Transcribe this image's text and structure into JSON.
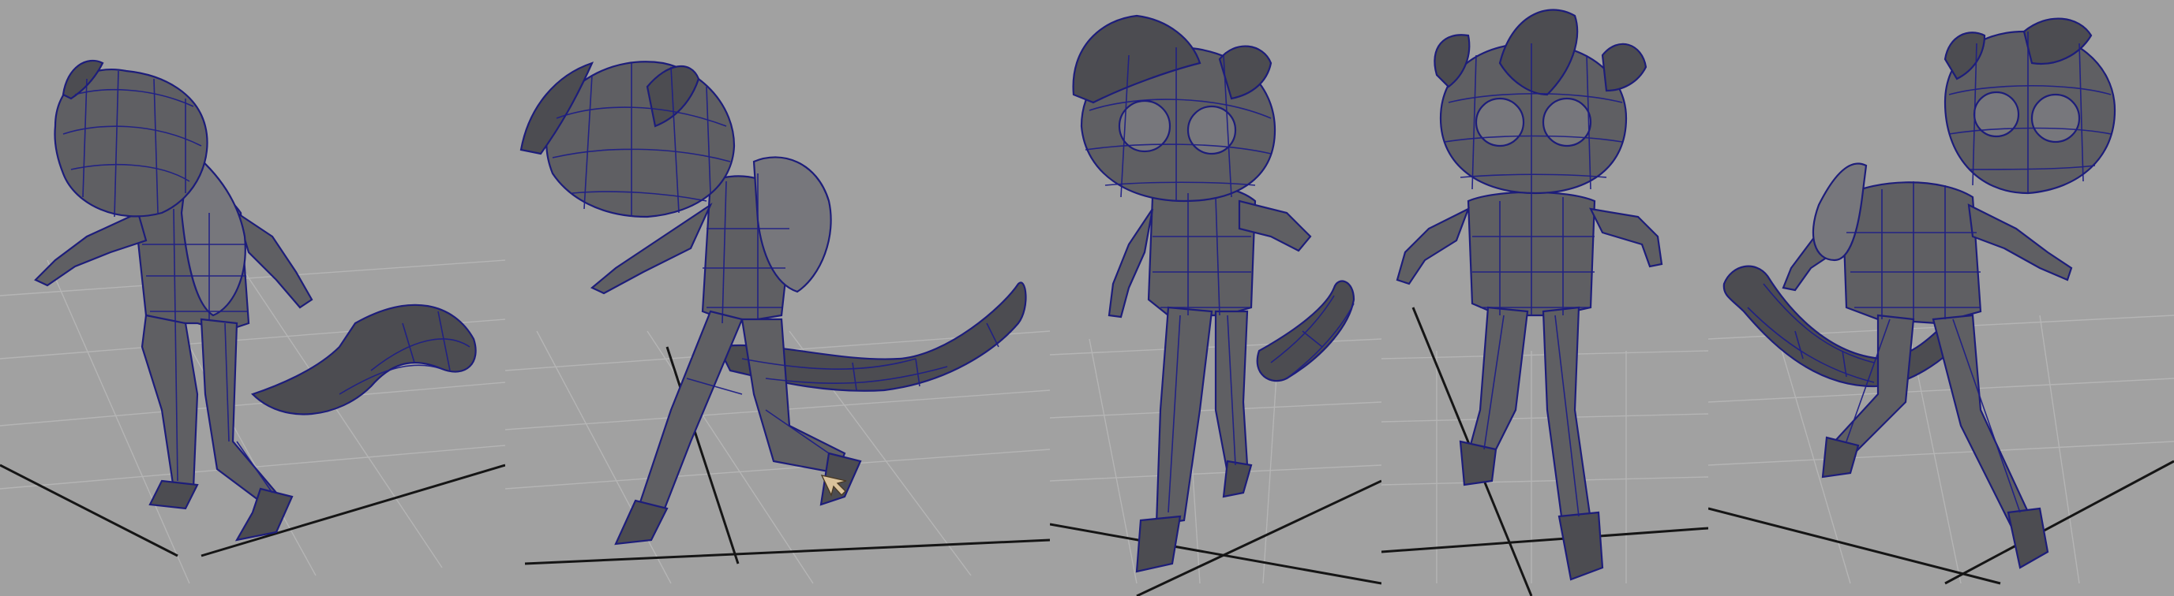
{
  "viewports": [
    {
      "view": "back-left-three-quarter",
      "character": "cartoon-cat-character-wireframe"
    },
    {
      "view": "left-side-three-quarter",
      "character": "cartoon-cat-character-wireframe"
    },
    {
      "view": "front-right-three-quarter",
      "character": "cartoon-cat-character-wireframe"
    },
    {
      "view": "front",
      "character": "cartoon-cat-character-wireframe"
    },
    {
      "view": "front-left-three-quarter",
      "character": "cartoon-cat-character-wireframe"
    }
  ],
  "colors": {
    "background": "#a1a1a1",
    "mesh": "#5f5f63",
    "wireframe": "#1d1d7a",
    "grid": "#b5b5b5",
    "axis": "#151515"
  },
  "icons": {
    "cursor": "arrow-cursor-icon"
  }
}
